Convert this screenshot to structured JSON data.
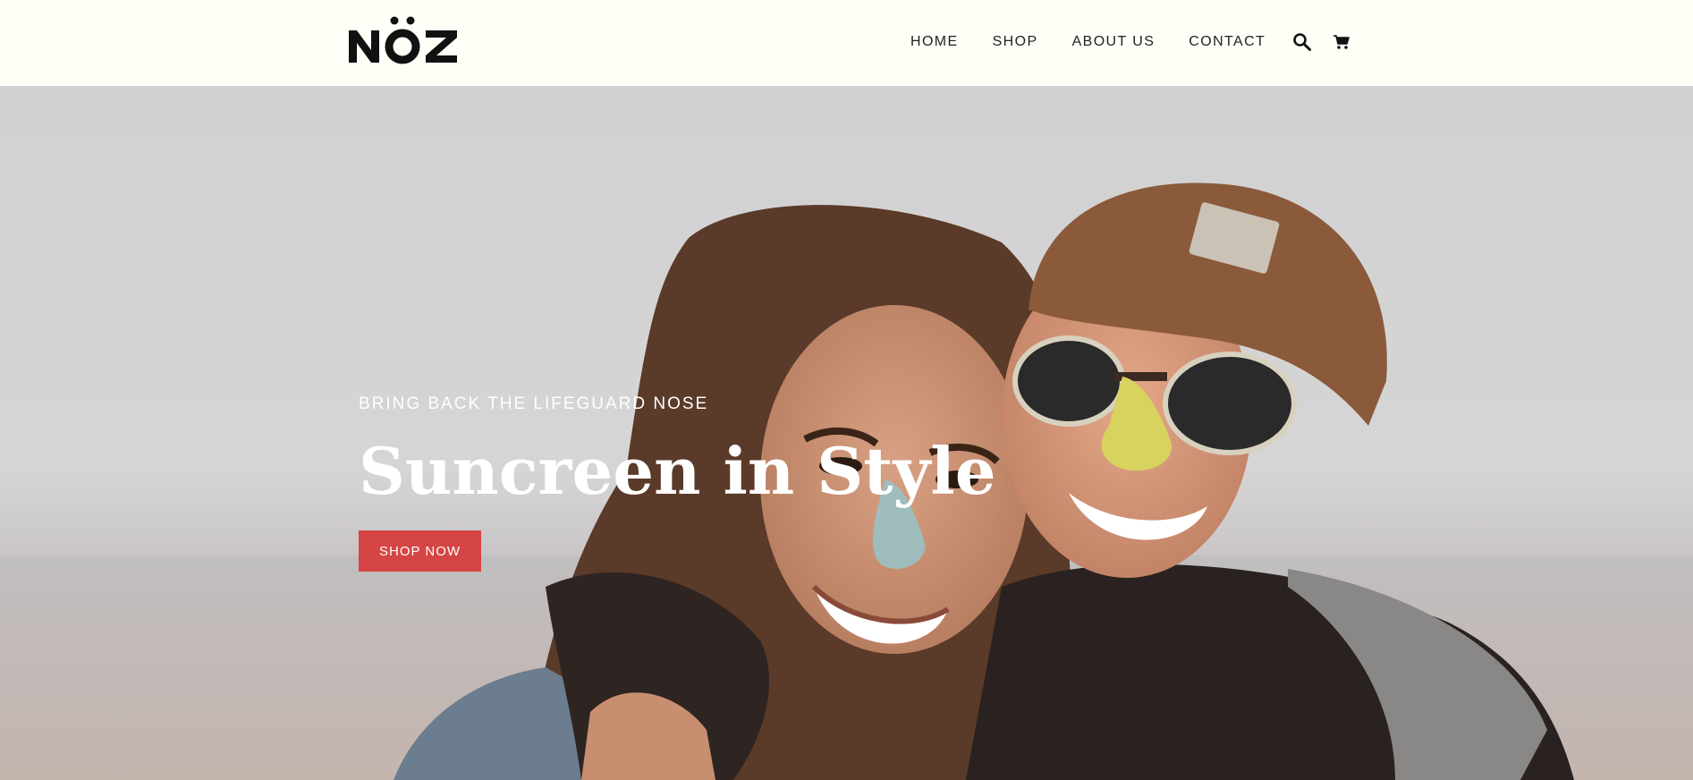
{
  "brand": {
    "logo_text": "NÖZ"
  },
  "nav": {
    "items": [
      {
        "label": "HOME"
      },
      {
        "label": "SHOP"
      },
      {
        "label": "ABOUT US"
      },
      {
        "label": "CONTACT"
      }
    ],
    "icons": [
      "search-icon",
      "cart-icon"
    ]
  },
  "hero": {
    "subheading": "BRING BACK THE LIFEGUARD NOSE",
    "headline": "Suncreen in Style",
    "cta_label": "SHOP NOW"
  },
  "colors": {
    "header_bg": "#fffff8",
    "cta": "#d64545",
    "text": "#222222"
  }
}
